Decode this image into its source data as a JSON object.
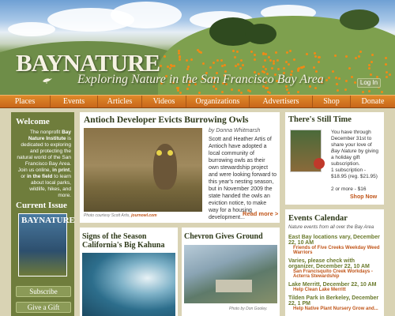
{
  "header": {
    "logo": "BAYNATURE",
    "tagline": "Exploring Nature in the San Francisco Bay Area",
    "login_label": "Log In"
  },
  "nav": {
    "items": [
      "Places",
      "Events",
      "Articles",
      "Videos",
      "Organizations",
      "Advertisers",
      "Shop",
      "Donate"
    ]
  },
  "welcome": {
    "title": "Welcome",
    "p1": "The nonprofit ",
    "org": "Bay Nature Institute",
    "p2": " is dedicated to exploring and protecting the natural world of the San Francisco Bay Area. Join us online, ",
    "inprint": "in print",
    "p3": ", or ",
    "inthefield": "in the field",
    "p4": " to learn about local parks, wildlife, hikes, and more."
  },
  "current_issue": {
    "title": "Current Issue",
    "cover_title": "BAYNATURE",
    "subscribe_label": "Subscribe",
    "gift_label": "Give a Gift"
  },
  "feature": {
    "title": "Antioch Developer Evicts Burrowing Owls",
    "byline": "by Donna Whitmarsh",
    "body": "Scott and Heather Artis of Antioch have adopted a local community of burrowing owls as their own stewardship project and were looking forward to this year's nesting season, but in November 2009 the state handed the owls an eviction notice, to make way for a housing development...",
    "credit": "Photo courtesy Scott Artis, ",
    "credit_link": "journowl.com",
    "read_more": "Read more >"
  },
  "story1": {
    "title": "Signs of the Season California's Big Kahuna"
  },
  "story2": {
    "title": "Chevron Gives Ground",
    "credit": "Photo by Don Gooley."
  },
  "promo": {
    "title": "There's Still Time",
    "text_a": "You have through December 31st to share your love of ",
    "mag": "Bay Nature",
    "text_b": " by giving a holiday gift subscription.",
    "price1": "1 subscription - $18.95 (reg. $21.95)",
    "price2": "2 or more - $16",
    "shop_now": "Shop Now"
  },
  "events": {
    "title": "Events Calendar",
    "subtitle": "Nature events from all over the Bay Area",
    "items": [
      {
        "heading": "East Bay locations vary, December 22, 10 AM",
        "link": "Friends of Five Creeks Weekday Weed Warriors"
      },
      {
        "heading": "Varies, please check with organizer, December 22, 10 AM",
        "link": "San Francisquito Creek Workdays - Acterra Stewardship"
      },
      {
        "heading": "Lake Merritt, December 22, 10 AM",
        "link": "Help Clean Lake Merritt"
      },
      {
        "heading": "Tilden Park in Berkeley, December 22, 1 PM",
        "link": "Help Native Plant Nursery Grow and..."
      }
    ]
  },
  "colors": {
    "nav": "#d8782a",
    "olive": "#6f7d3c",
    "accent_link": "#c1561a",
    "background": "#d9d3b4"
  }
}
